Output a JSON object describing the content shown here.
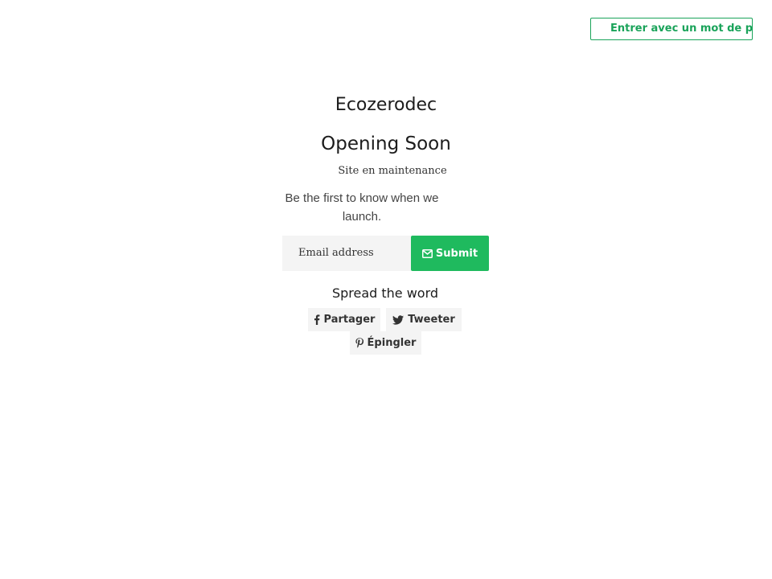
{
  "header": {
    "password_button_label": "Entrer avec un mot de passe"
  },
  "main": {
    "site_name": "Ecozerodec",
    "heading": "Opening Soon",
    "message": "Site en maintenance",
    "subtext": "Be the first to know when we launch."
  },
  "newsletter": {
    "email_placeholder": "Email address",
    "submit_label": "Submit"
  },
  "share": {
    "heading": "Spread the word",
    "facebook_label": "Partager",
    "twitter_label": "Tweeter",
    "pinterest_label": "Épingler"
  },
  "colors": {
    "accent": "#1fba5e",
    "accent_border": "#1aa35a",
    "button_background": "#f4f4f4"
  },
  "icons": [
    "envelope-icon",
    "facebook-icon",
    "twitter-icon",
    "pinterest-icon"
  ]
}
